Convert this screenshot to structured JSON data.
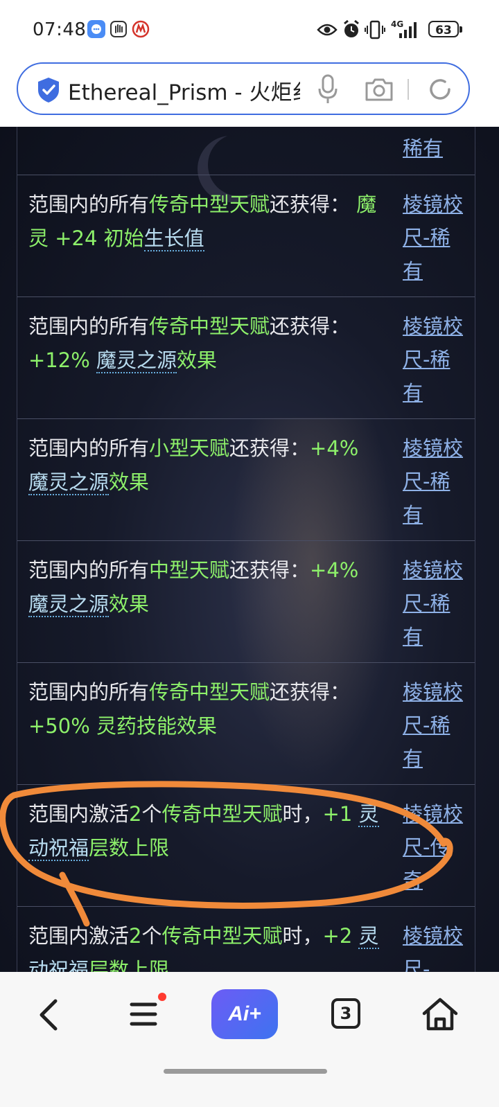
{
  "status": {
    "time": "07:48",
    "network": "4G",
    "battery": "63"
  },
  "browser": {
    "url_text": "Ethereal_Prism - 火炬纟"
  },
  "table": {
    "rows": [
      {
        "desc": [
          {
            "t": "稀有",
            "c": "hidden"
          }
        ],
        "src": "稀有"
      },
      {
        "desc": [
          {
            "t": "范围内的所有",
            "c": ""
          },
          {
            "t": "传奇中型天赋",
            "c": "g"
          },
          {
            "t": "还获得：  ",
            "c": ""
          },
          {
            "t": "魔灵 +24 初始",
            "c": "g"
          },
          {
            "t": "生长值",
            "c": "l"
          }
        ],
        "src": "棱镜校尺-稀有"
      },
      {
        "desc": [
          {
            "t": "范围内的所有",
            "c": ""
          },
          {
            "t": "传奇中型天赋",
            "c": "g"
          },
          {
            "t": "还获得：  ",
            "c": ""
          },
          {
            "t": "+12% ",
            "c": "g"
          },
          {
            "t": "魔灵之源",
            "c": "l"
          },
          {
            "t": "效果",
            "c": "g"
          }
        ],
        "src": "棱镜校尺-稀有"
      },
      {
        "desc": [
          {
            "t": "范围内的所有",
            "c": ""
          },
          {
            "t": "小型天赋",
            "c": "g"
          },
          {
            "t": "还获得：",
            "c": ""
          },
          {
            "t": "+4% ",
            "c": "g"
          },
          {
            "t": "魔灵之源",
            "c": "l"
          },
          {
            "t": "效果",
            "c": "g"
          }
        ],
        "src": "棱镜校尺-稀有"
      },
      {
        "desc": [
          {
            "t": "范围内的所有",
            "c": ""
          },
          {
            "t": "中型天赋",
            "c": "g"
          },
          {
            "t": "还获得：",
            "c": ""
          },
          {
            "t": "+4% ",
            "c": "g"
          },
          {
            "t": "魔灵之源",
            "c": "l"
          },
          {
            "t": "效果",
            "c": "g"
          }
        ],
        "src": "棱镜校尺-稀有"
      },
      {
        "desc": [
          {
            "t": "范围内的所有",
            "c": ""
          },
          {
            "t": "传奇中型天赋",
            "c": "g"
          },
          {
            "t": "还获得：  ",
            "c": ""
          },
          {
            "t": "+50% 灵药技能效果",
            "c": "g"
          }
        ],
        "src": "棱镜校尺-稀有"
      },
      {
        "desc": [
          {
            "t": "范围内激活",
            "c": ""
          },
          {
            "t": "2",
            "c": "g"
          },
          {
            "t": "个",
            "c": ""
          },
          {
            "t": "传奇中型天赋",
            "c": "g"
          },
          {
            "t": "时，",
            "c": ""
          },
          {
            "t": "+1 ",
            "c": "g"
          },
          {
            "t": "灵动祝福",
            "c": "l"
          },
          {
            "t": "层数上限",
            "c": "g"
          }
        ],
        "src": "棱镜校尺-传奇"
      },
      {
        "desc": [
          {
            "t": "范围内激活",
            "c": ""
          },
          {
            "t": "2",
            "c": "g"
          },
          {
            "t": "个",
            "c": ""
          },
          {
            "t": "传奇中型天赋",
            "c": "g"
          },
          {
            "t": "时，",
            "c": ""
          },
          {
            "t": "+2 ",
            "c": "g"
          },
          {
            "t": "灵动祝福",
            "c": "l"
          },
          {
            "t": "层数上限",
            "c": "g"
          }
        ],
        "src": "棱镜校尺-"
      }
    ]
  },
  "navbar": {
    "ai_label": "Ai+",
    "tab_count": "3"
  },
  "colors": {
    "accent": "#3f6de0",
    "highlight_green": "#8df06a",
    "link": "#8fb2e8",
    "annotation": "#f08a3a"
  }
}
